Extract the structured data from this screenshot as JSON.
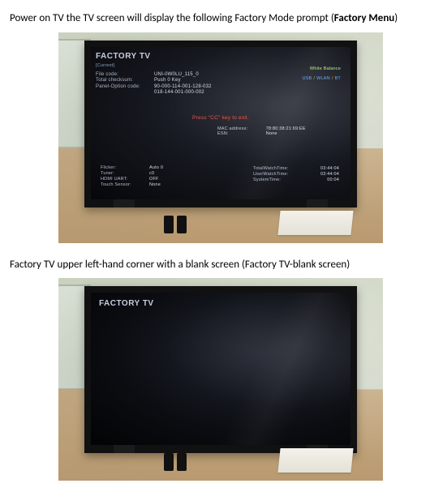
{
  "caption1_prefix": "Power on TV the TV screen will display the following Factory Mode prompt (",
  "caption1_bold": "Factory Menu",
  "caption1_suffix": ")",
  "caption2": "Factory TV upper left-hand corner with a blank screen (Factory TV-blank screen)",
  "tv1": {
    "title": "FACTORY TV",
    "subtitle": "[Current]",
    "rows": [
      {
        "label": "File code:",
        "value": "UNI-0W0LU_115_0"
      },
      {
        "label": "Total checksum:",
        "value": "Push 0 Key"
      },
      {
        "label": "Panel-Option code:",
        "value": "90-000-114-001-128-032"
      },
      {
        "label": "",
        "value": "018-144-001-000-002"
      }
    ],
    "whiteBalance": "White Balance",
    "ports": {
      "a": "USB",
      "b": "WLAN",
      "c": "BT"
    },
    "exit": "Press \"CC\" key to exit.",
    "mid": [
      {
        "label": "MAC address:",
        "value": "78:80:38:21:69:EE"
      },
      {
        "label": "ESN:",
        "value": "None"
      }
    ],
    "lowleft": [
      {
        "label": "Flicker:",
        "value": "Auto 0"
      },
      {
        "label": "Tuner:",
        "value": "c0"
      },
      {
        "label": "HDMI UART:",
        "value": "OFF"
      },
      {
        "label": "Touch Sensor:",
        "value": "None"
      }
    ],
    "lowright": [
      {
        "label": "TotalWatchTime:",
        "value": "03:44:04"
      },
      {
        "label": "UserWatchTime:",
        "value": "03:44:04"
      },
      {
        "label": "SystemTime:",
        "value": "00:04"
      }
    ]
  },
  "tv2": {
    "title": "FACTORY TV"
  }
}
